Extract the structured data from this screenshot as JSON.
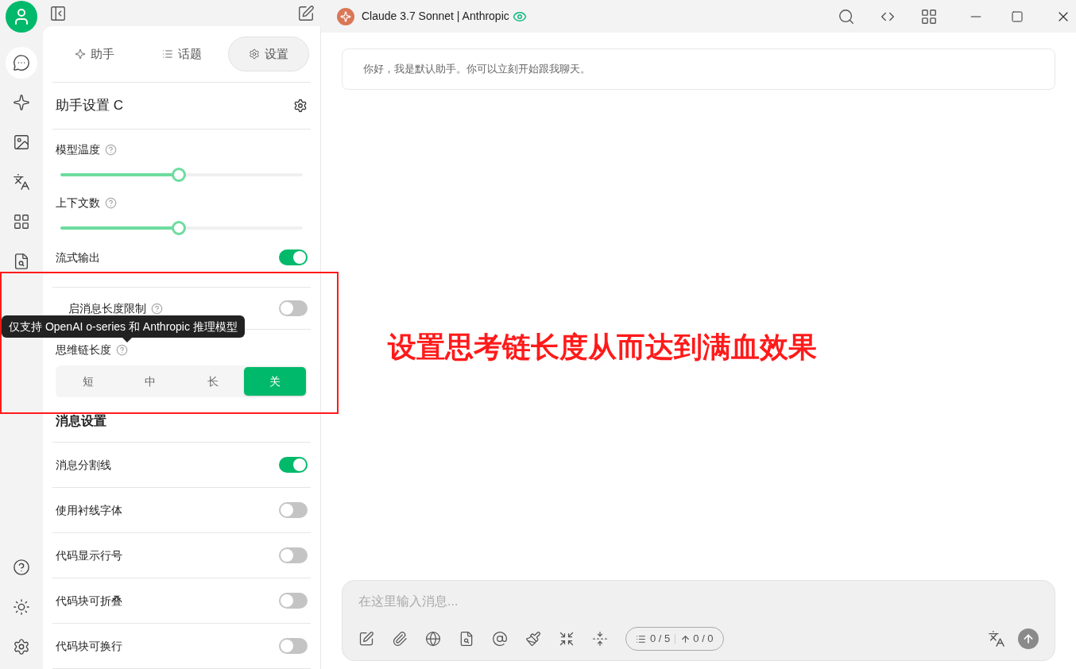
{
  "window": {
    "model_title": "Claude 3.7 Sonnet | Anthropic"
  },
  "rail": {
    "top": [
      {
        "kind": "chat",
        "selected": true
      },
      {
        "kind": "sparkle",
        "selected": false
      },
      {
        "kind": "image",
        "selected": false
      },
      {
        "kind": "translate",
        "selected": false
      },
      {
        "kind": "apps",
        "selected": false
      },
      {
        "kind": "document",
        "selected": false
      }
    ],
    "bottom": [
      {
        "kind": "help"
      },
      {
        "kind": "theme"
      },
      {
        "kind": "settings"
      }
    ]
  },
  "panel": {
    "tabs": [
      {
        "kind": "assistant",
        "label": "助手",
        "selected": false
      },
      {
        "kind": "topics",
        "label": "话题",
        "selected": false
      },
      {
        "kind": "settings",
        "label": "设置",
        "selected": true
      }
    ],
    "assistant_settings": {
      "title": "助手设置 C"
    },
    "sliders": [
      {
        "label": "模型温度",
        "help": true,
        "level": 0.49
      },
      {
        "label": "上下文数",
        "help": true,
        "level": 0.49
      }
    ],
    "toggles": [
      {
        "label": "流式输出",
        "help": false,
        "on": true
      },
      {
        "label": "启消息长度限制",
        "help": true,
        "on": false
      }
    ],
    "thinking": {
      "label": "思维链长度",
      "help": true,
      "options": [
        {
          "label": "短",
          "selected": false
        },
        {
          "label": "中",
          "selected": false
        },
        {
          "label": "长",
          "selected": false
        },
        {
          "label": "关",
          "selected": true
        }
      ]
    },
    "message_settings": {
      "title": "消息设置",
      "toggles": [
        {
          "label": "消息分割线",
          "on": true
        },
        {
          "label": "使用衬线字体",
          "on": false
        },
        {
          "label": "代码显示行号",
          "on": false
        },
        {
          "label": "代码块可折叠",
          "on": false
        },
        {
          "label": "代码块可换行",
          "on": false
        }
      ]
    }
  },
  "tooltip": {
    "text": "仅支持 OpenAI o-series 和 Anthropic 推理模型"
  },
  "chat": {
    "greeting": "你好，我是默认助手。你可以立刻开始跟我聊天。"
  },
  "input": {
    "placeholder": "在这里输入消息...",
    "context_count": "0 / 5",
    "token_count": "0 / 0"
  },
  "annotation": {
    "text": "设置思考链长度从而达到满血效果"
  }
}
